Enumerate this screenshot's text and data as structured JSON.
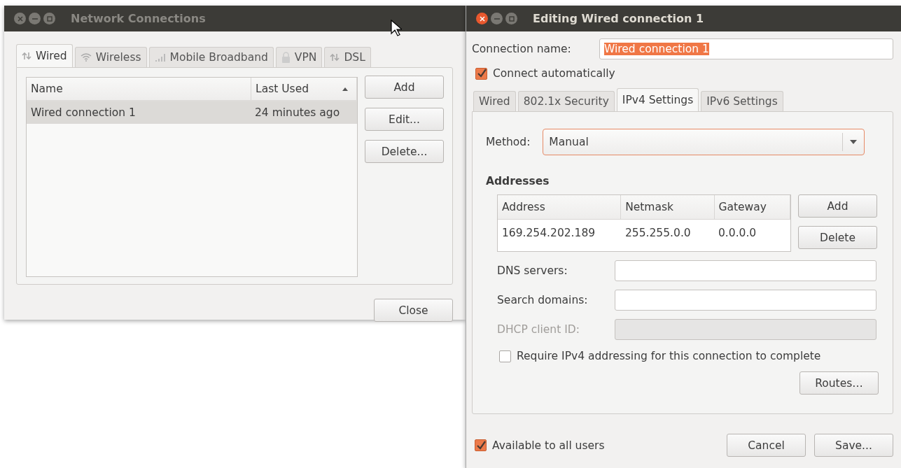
{
  "network_connections": {
    "title": "Network Connections",
    "active": false,
    "tabs": [
      {
        "label": "Wired",
        "kind": "wired",
        "selected": true
      },
      {
        "label": "Wireless",
        "kind": "wireless",
        "selected": false
      },
      {
        "label": "Mobile Broadband",
        "kind": "mobile",
        "selected": false
      },
      {
        "label": "VPN",
        "kind": "vpn",
        "selected": false
      },
      {
        "label": "DSL",
        "kind": "dsl",
        "selected": false
      }
    ],
    "columns": [
      {
        "label": "Name",
        "sorted": false
      },
      {
        "label": "Last Used",
        "sorted": true
      }
    ],
    "rows": [
      {
        "cells": [
          "Wired connection 1",
          "24 minutes ago"
        ],
        "selected": true
      }
    ],
    "buttons": [
      "Add",
      "Edit...",
      "Delete..."
    ],
    "close_button": "Close"
  },
  "editor": {
    "title": "Editing Wired connection 1",
    "active": true,
    "connection_name": {
      "label": "Connection name:",
      "value": "Wired connection 1",
      "text_selected": true
    },
    "connect_automatically": {
      "label": "Connect automatically",
      "checked": true
    },
    "tabs": [
      {
        "label": "Wired",
        "selected": false
      },
      {
        "label": "802.1x Security",
        "selected": false
      },
      {
        "label": "IPv4 Settings",
        "selected": true
      },
      {
        "label": "IPv6 Settings",
        "selected": false
      }
    ],
    "method": {
      "label": "Method:",
      "value": "Manual"
    },
    "addresses": {
      "heading": "Addresses",
      "columns": [
        "Address",
        "Netmask",
        "Gateway"
      ],
      "rows": [
        [
          "169.254.202.189",
          "255.255.0.0",
          "0.0.0.0"
        ]
      ],
      "buttons": [
        "Add",
        "Delete"
      ]
    },
    "fields": [
      {
        "label": "DNS servers:",
        "disabled": false
      },
      {
        "label": "Search domains:",
        "disabled": false
      },
      {
        "label": "DHCP client ID:",
        "disabled": true
      }
    ],
    "require_ipv4": {
      "label": "Require IPv4 addressing for this connection to complete",
      "checked": false
    },
    "routes_button": "Routes…",
    "available_to_all": {
      "label": "Available to all users",
      "checked": true
    },
    "buttons": [
      "Cancel",
      "Save..."
    ]
  }
}
